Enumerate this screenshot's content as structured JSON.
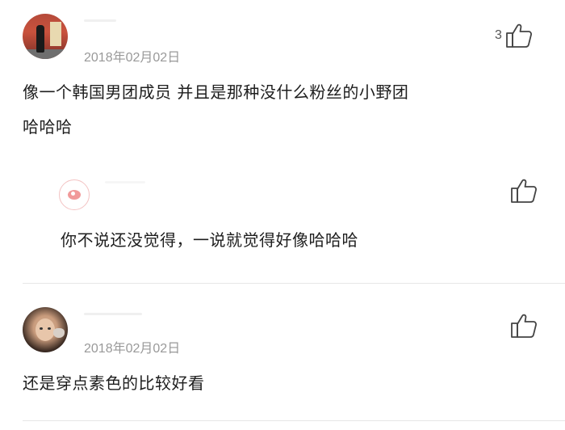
{
  "comments": [
    {
      "date": "2018年02月02日",
      "likes": "3",
      "text_line1": "像一个韩国男团成员 并且是那种没什么粉丝的小野团",
      "text_line2": "哈哈哈",
      "reply": {
        "text": "你不说还没觉得，一说就觉得好像哈哈哈"
      }
    },
    {
      "date": "2018年02月02日",
      "text": "还是穿点素色的比较好看"
    }
  ],
  "icons": {
    "like": "thumbs-up-icon"
  }
}
